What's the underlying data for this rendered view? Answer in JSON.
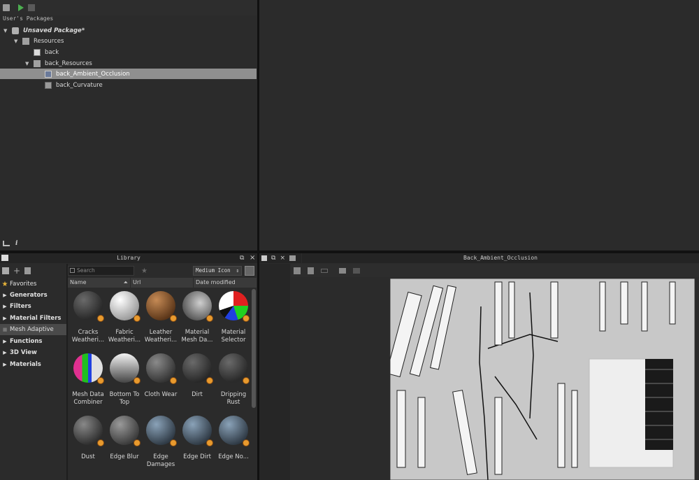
{
  "explorer": {
    "header": "User's Packages",
    "package_name": "Unsaved Package*",
    "resources": "Resources",
    "back": "back",
    "back_resources": "back_Resources",
    "ao": "back_Ambient_Occlusion",
    "curvature": "back_Curvature",
    "info_glyph": "i"
  },
  "library": {
    "title": "Library",
    "search_placeholder": "Search",
    "view_mode": "Medium Icon",
    "columns": [
      "Name",
      "Url",
      "Date modified"
    ],
    "categories": [
      "Favorites",
      "Generators",
      "Filters",
      "Material Filters",
      "Mesh Adaptive",
      "Functions",
      "3D View",
      "Materials"
    ],
    "items": [
      {
        "label": "Cracks Weatheri...",
        "style": "dark-rock"
      },
      {
        "label": "Fabric Weatheri...",
        "style": "white-marble"
      },
      {
        "label": "Leather Weatheri...",
        "style": "brown"
      },
      {
        "label": "Material Mesh Da...",
        "style": "multi"
      },
      {
        "label": "Material Selector",
        "style": "rgb"
      },
      {
        "label": "Mesh Data Combiner",
        "style": "rgb-split"
      },
      {
        "label": "Bottom To Top",
        "style": "gradient"
      },
      {
        "label": "Cloth Wear",
        "style": "grey"
      },
      {
        "label": "Dirt",
        "style": "dark-grey"
      },
      {
        "label": "Dripping Rust",
        "style": "dark-rock"
      },
      {
        "label": "Dust",
        "style": "grey-dark"
      },
      {
        "label": "Edge Blur",
        "style": "grey-edge"
      },
      {
        "label": "Edge Damages",
        "style": "blue-edge"
      },
      {
        "label": "Edge Dirt",
        "style": "blue-edge"
      },
      {
        "label": "Edge No...",
        "style": "blue-edge"
      }
    ]
  },
  "view2d": {
    "title": "Back_Ambient_Occlusion"
  },
  "colors": {
    "panel": "#2b2b2b",
    "selection": "#8f8f8f",
    "badge": "#e89a2e",
    "play": "#4caf50"
  }
}
